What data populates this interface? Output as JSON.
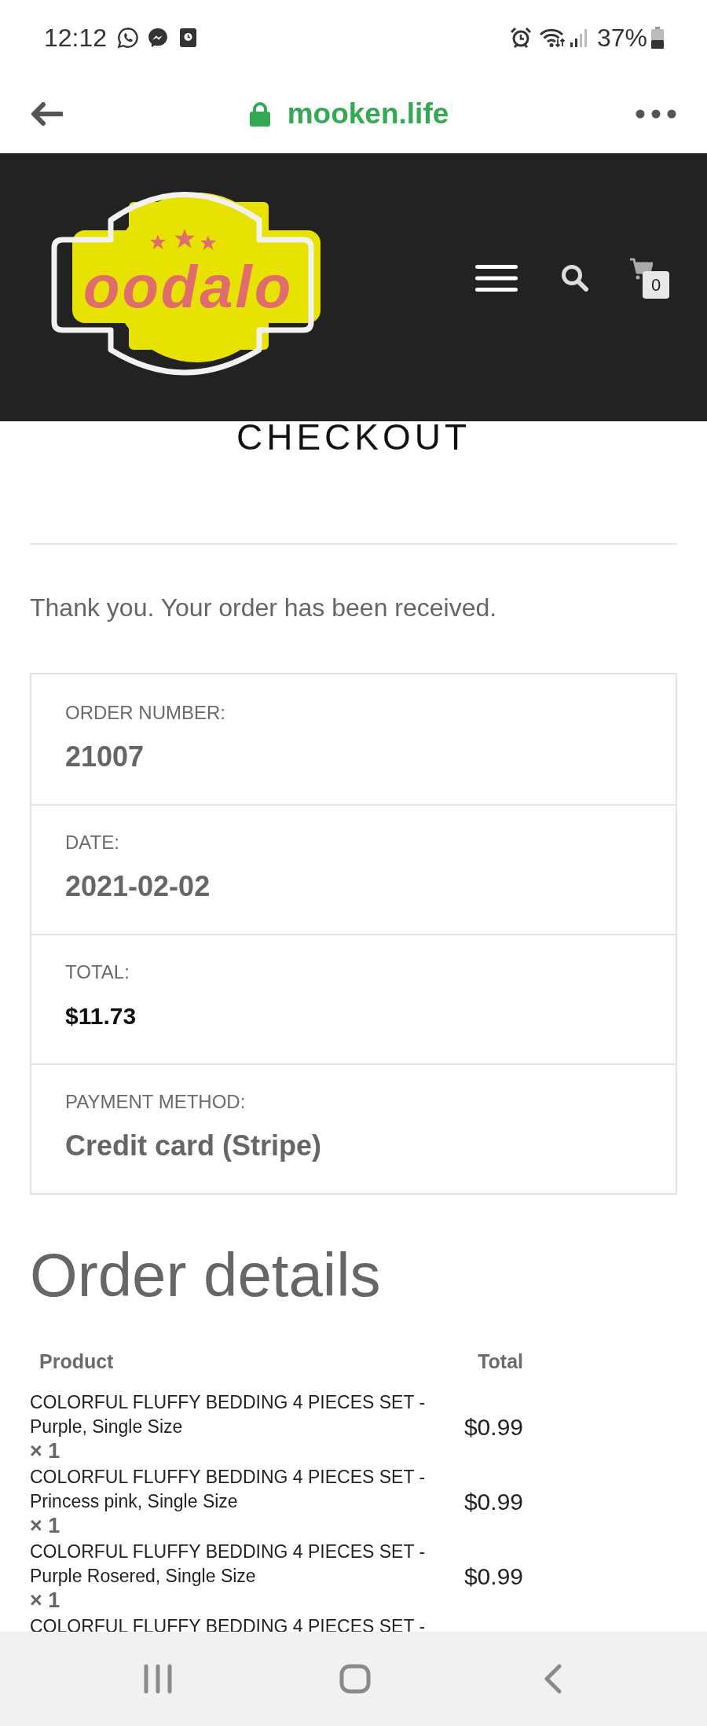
{
  "status_bar": {
    "time": "12:12",
    "battery": "37%"
  },
  "browser_bar": {
    "url": "mooken.life"
  },
  "site_header": {
    "logo_text": "oodalo",
    "cart_count": "0"
  },
  "page_title": "CHECKOUT",
  "confirmation": "Thank you. Your order has been received.",
  "order_overview": [
    {
      "label": "ORDER NUMBER:",
      "value": "21007",
      "kind": "plain"
    },
    {
      "label": "DATE:",
      "value": "2021-02-02",
      "kind": "plain"
    },
    {
      "label": "TOTAL:",
      "value": "$11.73",
      "kind": "amount"
    },
    {
      "label": "PAYMENT METHOD:",
      "value": "Credit card (Stripe)",
      "kind": "plain"
    }
  ],
  "order_details": {
    "heading": "Order details",
    "columns": [
      "Product",
      "Total"
    ],
    "rows": [
      {
        "product": "COLORFUL FLUFFY BEDDING 4 PIECES SET - Purple, Single Size",
        "quantity": "× 1",
        "total": "$0.99"
      },
      {
        "product": "COLORFUL FLUFFY BEDDING 4 PIECES SET - Princess pink, Single Size",
        "quantity": "× 1",
        "total": "$0.99"
      },
      {
        "product": "COLORFUL FLUFFY BEDDING 4 PIECES SET - Purple Rosered, Single Size",
        "quantity": "× 1",
        "total": "$0.99"
      },
      {
        "product": "COLORFUL FLUFFY BEDDING 4 PIECES SET -"
      }
    ]
  }
}
